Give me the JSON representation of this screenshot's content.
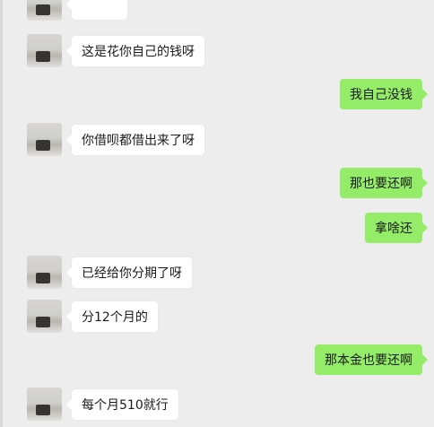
{
  "messages": [
    {
      "side": "in",
      "text": ""
    },
    {
      "side": "in",
      "text": "这是花你自己的钱呀"
    },
    {
      "side": "out",
      "text": "我自己没钱"
    },
    {
      "side": "in",
      "text": "你借呗都借出来了呀"
    },
    {
      "side": "out",
      "text": "那也要还啊"
    },
    {
      "side": "out",
      "text": "拿啥还"
    },
    {
      "side": "in",
      "text": "已经给你分期了呀"
    },
    {
      "side": "in",
      "text": "分12个月的"
    },
    {
      "side": "out",
      "text": "那本金也要还啊"
    },
    {
      "side": "in",
      "text": "每个月510就行"
    }
  ],
  "colors": {
    "background": "#ededed",
    "incoming_bubble": "#ffffff",
    "outgoing_bubble": "#95ec69"
  }
}
